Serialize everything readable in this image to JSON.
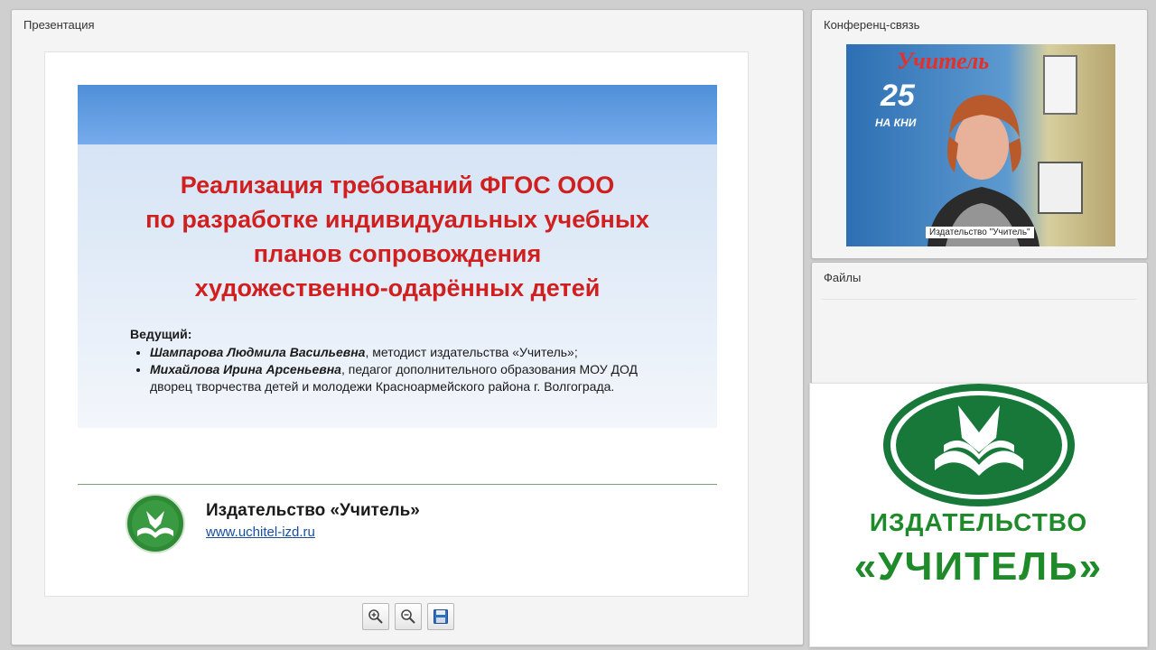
{
  "presentation": {
    "panel_title": "Презентация",
    "slide": {
      "title_lines": [
        "Реализация требований ФГОС ООО",
        "по разработке индивидуальных учебных",
        "планов сопровождения",
        "художественно-одарённых детей"
      ],
      "presenters_heading": "Ведущий:",
      "presenters": [
        {
          "name": "Шампарова Людмила Васильевна",
          "desc": ", методист издательства «Учитель»;"
        },
        {
          "name": "Михайлова Ирина Арсеньевна",
          "desc": ", педагог дополнительного образования МОУ ДОД дворец творчества детей и молодежи Красноармейского района г. Волгограда."
        }
      ],
      "publisher": "Издательство «Учитель»",
      "url": "www.uchitel-izd.ru"
    },
    "toolbar": {
      "zoom_in_icon": "zoom-in-icon",
      "zoom_out_icon": "zoom-out-icon",
      "save_icon": "save-icon"
    }
  },
  "conference": {
    "panel_title": "Конференц-связь",
    "video": {
      "banner_text": "Учитель",
      "banner_number": "25",
      "banner_sub": "НА КНИ",
      "caption": "Издательство \"Учитель\""
    }
  },
  "files": {
    "panel_title": "Файлы"
  },
  "logo_panel": {
    "line1": "ИЗДАТЕЛЬСТВО",
    "line2": "«УЧИТЕЛЬ»"
  },
  "colors": {
    "slide_title": "#d01f1f",
    "brand_green": "#1e8a2a",
    "link": "#1a4fa0",
    "slide_band": "#4f8fd8"
  }
}
